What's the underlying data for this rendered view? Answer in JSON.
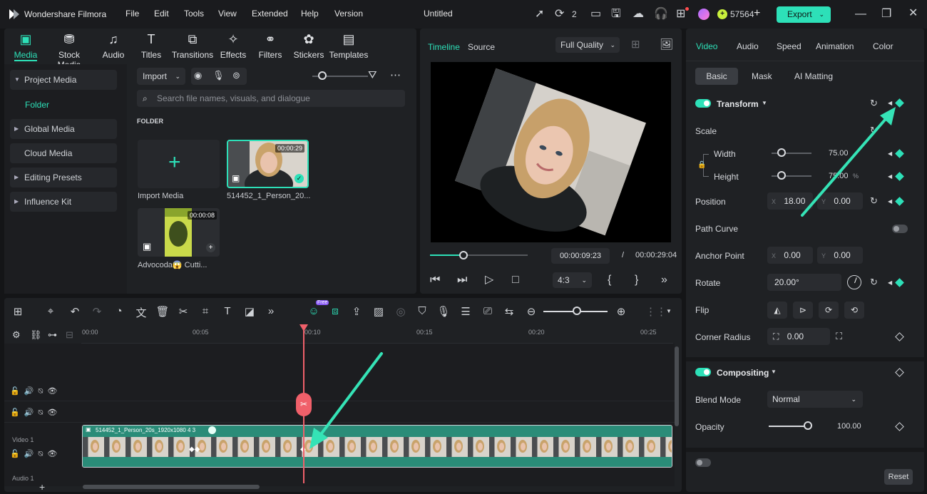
{
  "app": {
    "name": "Wondershare Filmora",
    "menu": [
      "File",
      "Edit",
      "Tools",
      "View",
      "Extended",
      "Help",
      "Version"
    ],
    "project_title": "Untitled",
    "render_count": "2",
    "credits": "57564",
    "export_label": "Export"
  },
  "toolbar": {
    "tabs": [
      "Media",
      "Stock Media",
      "Audio",
      "Titles",
      "Transitions",
      "Effects",
      "Filters",
      "Stickers",
      "Templates"
    ]
  },
  "sidebar": {
    "items": [
      "Project Media",
      "Folder",
      "Global Media",
      "Cloud Media",
      "Editing Presets",
      "Influence Kit"
    ]
  },
  "media": {
    "import_label": "Import",
    "search_placeholder": "Search file names, visuals, and dialogue",
    "folder_heading": "FOLDER",
    "import_tile_label": "Import Media",
    "clip1": {
      "name": "514452_1_Person_20...",
      "duration": "00:00:29"
    },
    "clip2": {
      "name": "Advocoda😱 Cutti...",
      "duration": "00:00:08"
    }
  },
  "player": {
    "tab_timeline": "Timeline",
    "tab_source": "Source",
    "quality": "Full Quality",
    "current_time": "00:00:09:23",
    "separator": "/",
    "total_time": "00:00:29:04",
    "aspect": "4:3",
    "progress": 0.34
  },
  "inspector": {
    "tabs": [
      "Video",
      "Audio",
      "Speed",
      "Animation",
      "Color"
    ],
    "subtabs": [
      "Basic",
      "Mask",
      "AI Matting"
    ],
    "transform_label": "Transform",
    "scale_label": "Scale",
    "width_label": "Width",
    "width_value": "75.00",
    "height_label": "Height",
    "height_value": "75.00",
    "height_unit": "%",
    "position_label": "Position",
    "pos_x_prefix": "X",
    "pos_x": "18.00",
    "pos_y_prefix": "Y",
    "pos_y": "0.00",
    "path_curve_label": "Path Curve",
    "anchor_label": "Anchor Point",
    "anchor_x": "0.00",
    "anchor_y": "0.00",
    "rotate_label": "Rotate",
    "rotate_value": "20.00°",
    "flip_label": "Flip",
    "corner_label": "Corner Radius",
    "corner_value": "0.00",
    "compositing_label": "Compositing",
    "blend_label": "Blend Mode",
    "blend_value": "Normal",
    "opacity_label": "Opacity",
    "opacity_value": "100.00",
    "reset_label": "Reset"
  },
  "timeline": {
    "ruler": [
      "00:00",
      "00:05",
      "00:10",
      "00:15",
      "00:20",
      "00:25"
    ],
    "free_badge": "Free",
    "video_track_label": "Video 1",
    "audio_track_label": "Audio 1",
    "clip_title": "514452_1_Person_20s_1920x1080 4 3"
  },
  "colors": {
    "accent": "#2de0b8",
    "playhead": "#f0606a",
    "clip": "#2a8c78"
  }
}
